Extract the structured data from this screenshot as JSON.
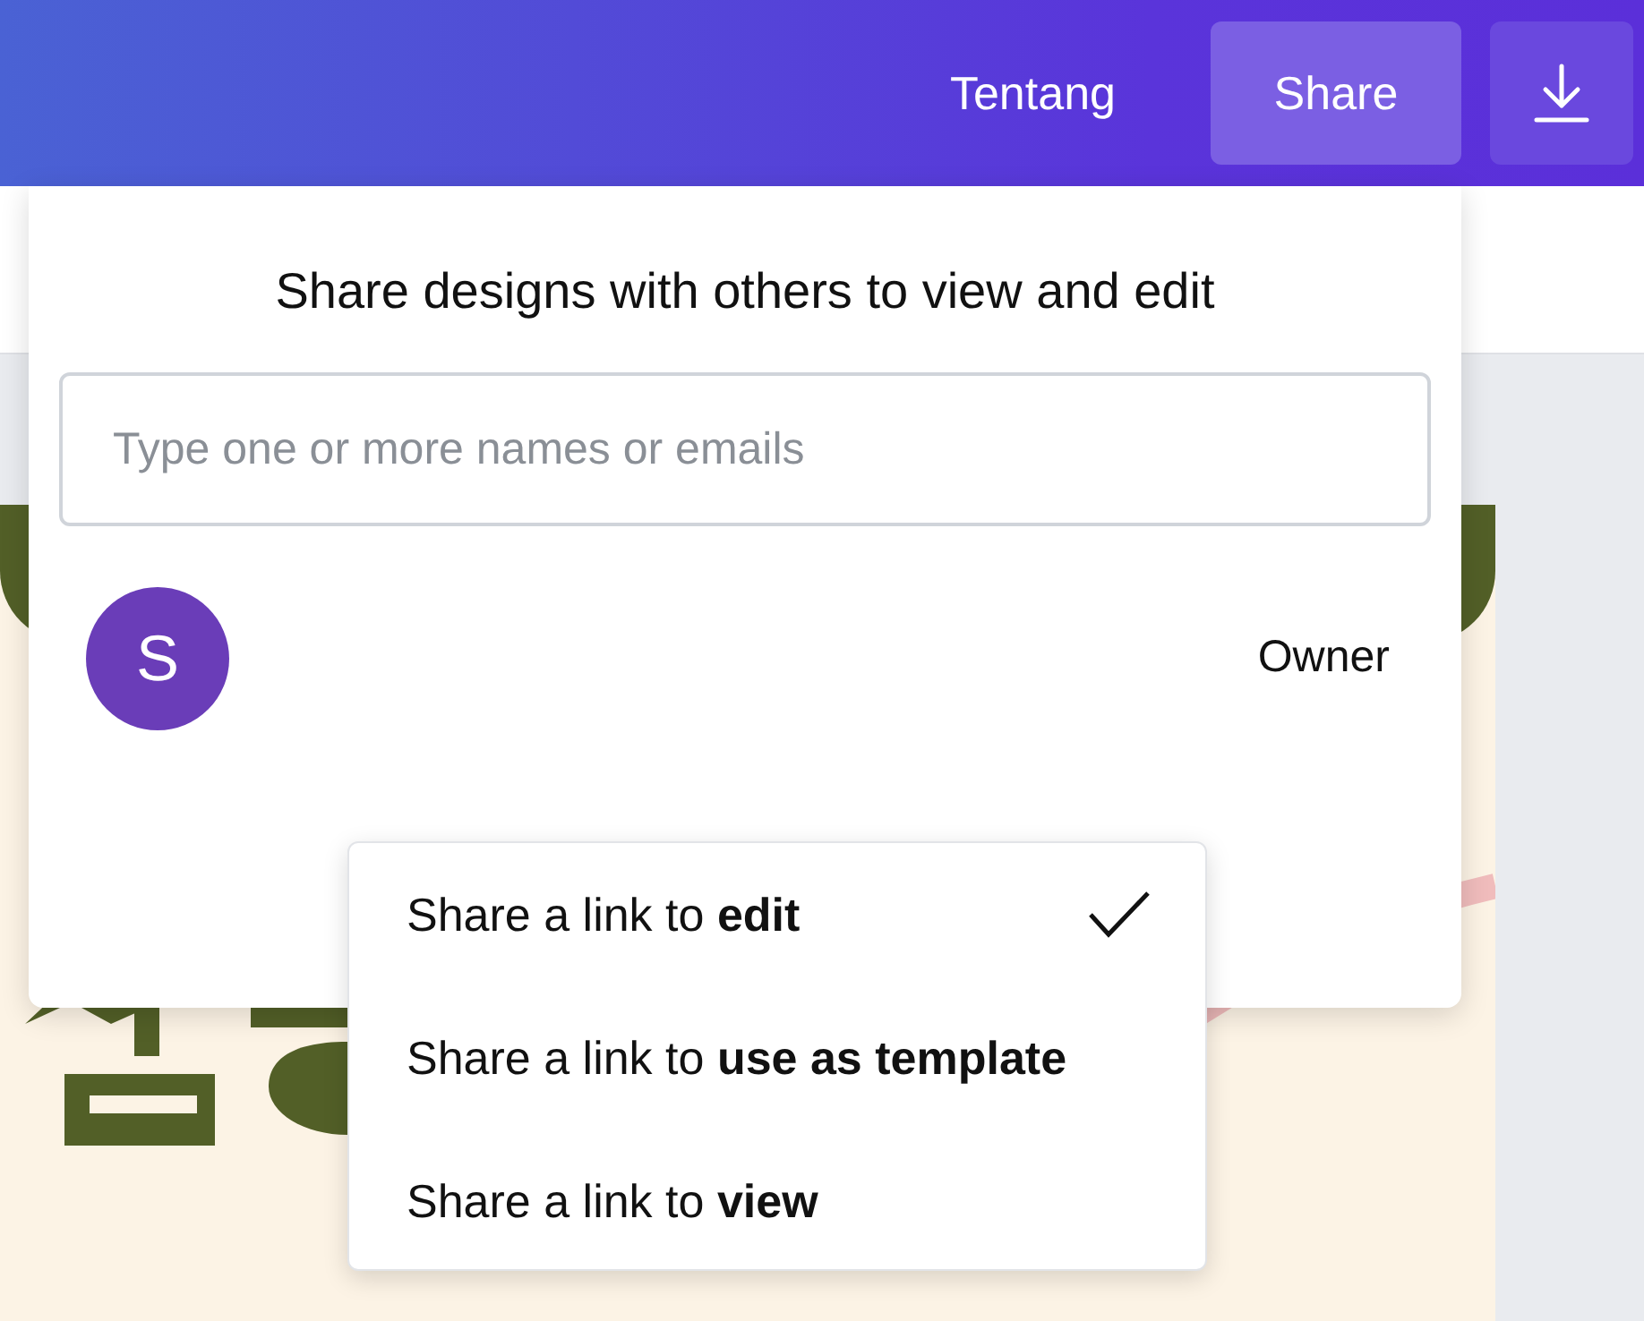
{
  "header": {
    "about_link": "Tentang",
    "share_button": "Share"
  },
  "share_popup": {
    "title": "Share designs with others to view and edit",
    "search": {
      "placeholder": "Type one or more names or emails"
    },
    "members": [
      {
        "initial": "S",
        "role": "Owner",
        "color": "#6a3db8"
      }
    ]
  },
  "link_menu": [
    {
      "label": "Share a link to **edit**",
      "selected": true
    },
    {
      "label": "Share a link to **use as template**",
      "selected": false
    },
    {
      "label": "Share a link to **view**",
      "selected": false
    }
  ]
}
